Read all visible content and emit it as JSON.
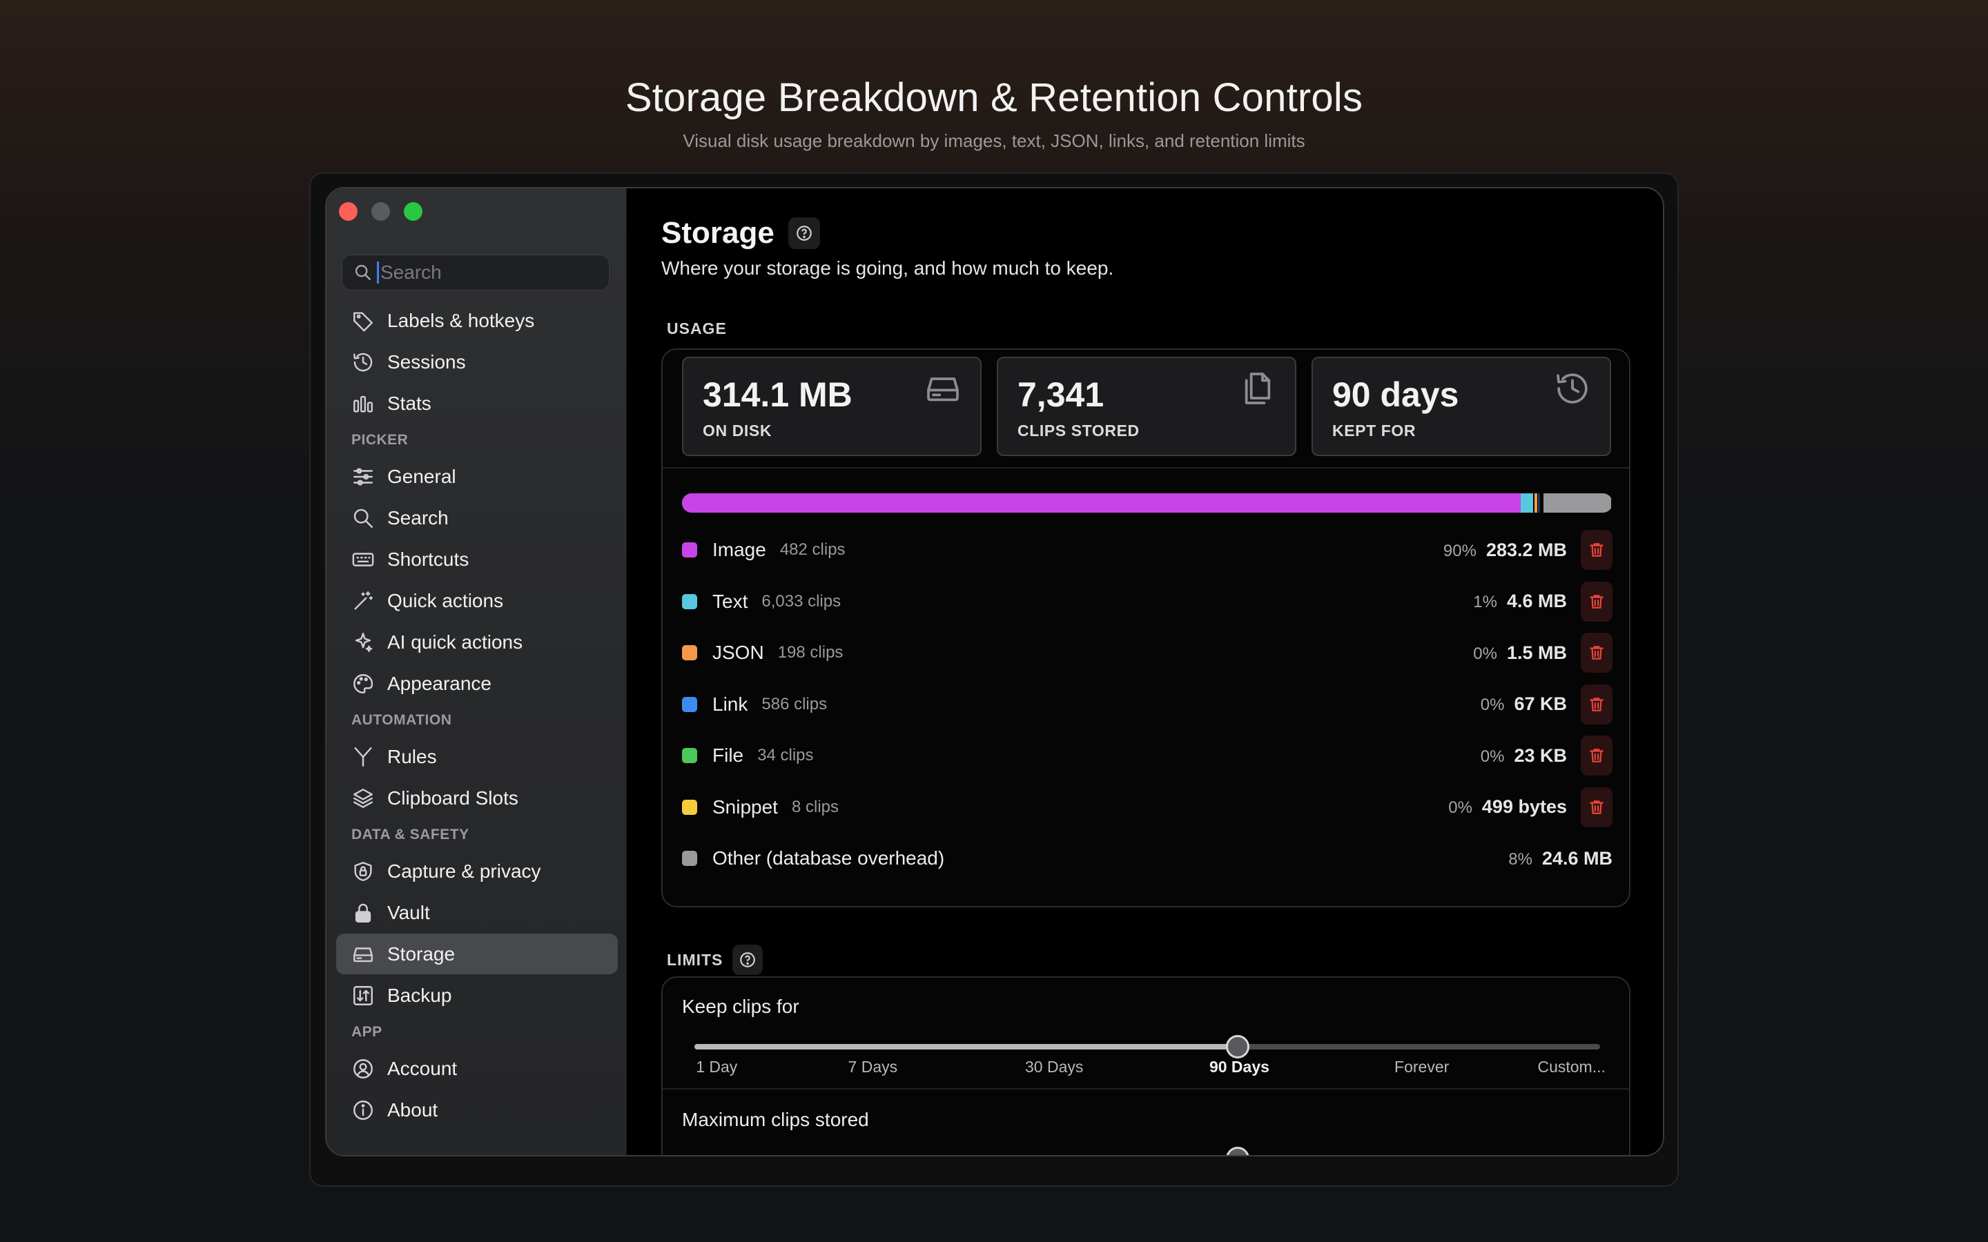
{
  "page": {
    "title": "Storage Breakdown & Retention Controls",
    "subtitle": "Visual disk usage breakdown by images, text, JSON, links, and retention limits"
  },
  "sidebar": {
    "search_placeholder": "Search",
    "items_top": [
      {
        "label": "Labels & hotkeys",
        "icon": "tag-icon"
      },
      {
        "label": "Sessions",
        "icon": "history-icon"
      },
      {
        "label": "Stats",
        "icon": "chart-icon"
      }
    ],
    "sections": [
      {
        "label": "PICKER",
        "items": [
          {
            "label": "General",
            "icon": "sliders-icon"
          },
          {
            "label": "Search",
            "icon": "search-icon"
          },
          {
            "label": "Shortcuts",
            "icon": "keyboard-icon"
          },
          {
            "label": "Quick actions",
            "icon": "wand-icon"
          },
          {
            "label": "AI quick actions",
            "icon": "sparkle-icon"
          },
          {
            "label": "Appearance",
            "icon": "palette-icon"
          }
        ]
      },
      {
        "label": "AUTOMATION",
        "items": [
          {
            "label": "Rules",
            "icon": "branch-icon"
          },
          {
            "label": "Clipboard Slots",
            "icon": "layers-icon"
          }
        ]
      },
      {
        "label": "DATA & SAFETY",
        "items": [
          {
            "label": "Capture & privacy",
            "icon": "shield-lock-icon"
          },
          {
            "label": "Vault",
            "icon": "lock-icon"
          },
          {
            "label": "Storage",
            "icon": "drive-icon",
            "active": true
          },
          {
            "label": "Backup",
            "icon": "backup-icon"
          }
        ]
      },
      {
        "label": "APP",
        "items": [
          {
            "label": "Account",
            "icon": "person-icon"
          },
          {
            "label": "About",
            "icon": "info-icon"
          }
        ]
      }
    ]
  },
  "main": {
    "title": "Storage",
    "subtitle": "Where your storage is going, and how much to keep.",
    "usage_label": "USAGE",
    "stats": [
      {
        "value": "314.1 MB",
        "label": "ON DISK",
        "icon": "drive-icon"
      },
      {
        "value": "7,341",
        "label": "CLIPS STORED",
        "icon": "documents-icon"
      },
      {
        "value": "90 days",
        "label": "KEPT FOR",
        "icon": "clock-history-icon"
      }
    ],
    "breakdown_bar": [
      {
        "name": "Image",
        "fraction": 0.9016,
        "color": "#c944e8"
      },
      {
        "name": "Text",
        "fraction": 0.0146,
        "color": "#56c8e0"
      },
      {
        "name": "JSON",
        "fraction": 0.0048,
        "color": "#f39a4a"
      },
      {
        "name": "Link",
        "fraction": 0.0021,
        "color": "#3d8bf0"
      },
      {
        "name": "File",
        "fraction": 0.0016,
        "color": "#4cc75a"
      },
      {
        "name": "Snippet",
        "fraction": 0.0014,
        "color": "#f5cc3d"
      },
      {
        "name": "Other (database overhead)",
        "fraction": 0.0739,
        "color": "#9a9a9c"
      }
    ],
    "categories": [
      {
        "name": "Image",
        "clips": "482 clips",
        "pct": "90%",
        "size": "283.2 MB",
        "color": "#c944e8",
        "deletable": true
      },
      {
        "name": "Text",
        "clips": "6,033 clips",
        "pct": "1%",
        "size": "4.6 MB",
        "color": "#56c8e0",
        "deletable": true
      },
      {
        "name": "JSON",
        "clips": "198 clips",
        "pct": "0%",
        "size": "1.5 MB",
        "color": "#f39a4a",
        "deletable": true
      },
      {
        "name": "Link",
        "clips": "586 clips",
        "pct": "0%",
        "size": "67 KB",
        "color": "#3d8bf0",
        "deletable": true
      },
      {
        "name": "File",
        "clips": "34 clips",
        "pct": "0%",
        "size": "23 KB",
        "color": "#4cc75a",
        "deletable": true
      },
      {
        "name": "Snippet",
        "clips": "8 clips",
        "pct": "0%",
        "size": "499 bytes",
        "color": "#f5cc3d",
        "deletable": true
      },
      {
        "name": "Other (database overhead)",
        "clips": "",
        "pct": "8%",
        "size": "24.6 MB",
        "color": "#9a9a9c",
        "deletable": false
      }
    ],
    "limits_label": "LIMITS",
    "keep_clips": {
      "title": "Keep clips for",
      "options": [
        "1 Day",
        "7 Days",
        "30 Days",
        "90 Days",
        "Forever",
        "Custom..."
      ],
      "selected_index": 3
    },
    "max_clips": {
      "title": "Maximum clips stored",
      "position_fraction": 0.6
    }
  }
}
